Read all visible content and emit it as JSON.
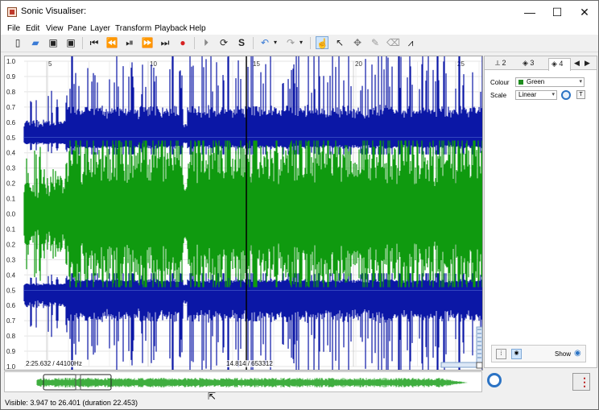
{
  "window": {
    "title": "Sonic Visualiser:",
    "controls": [
      "—",
      "☐",
      "✕"
    ]
  },
  "menu": [
    "File",
    "Edit",
    "View",
    "Pane",
    "Layer",
    "Transform",
    "Playback",
    "Help"
  ],
  "toolbar": {
    "icons": [
      "new-file-icon",
      "open-folder-icon",
      "save-icon",
      "save-as-icon",
      "rewind-start-icon",
      "rewind-icon",
      "play-pause-icon",
      "fast-forward-icon",
      "ffwd-end-icon",
      "record-icon",
      "play-selection-icon",
      "loop-icon",
      "solo-icon",
      "undo-icon",
      "redo-icon",
      "navigate-tool-icon",
      "select-tool-icon",
      "move-tool-icon",
      "draw-tool-icon",
      "erase-tool-icon",
      "measure-tool-icon"
    ],
    "selected_tool": "navigate-tool-icon"
  },
  "pane": {
    "time_ruler": [
      "5",
      "10",
      "15",
      "20",
      "25"
    ],
    "scale_labels_top": [
      "1.0",
      "0.9",
      "0.8",
      "0.7",
      "0.6",
      "0.5",
      "0.4",
      "0.3",
      "0.2",
      "0.1",
      "0.0",
      "0.1",
      "0.2",
      "0.3",
      "0.4",
      "0.5",
      "0.6",
      "0.7",
      "0.8",
      "0.9",
      "1.0"
    ],
    "left_readout": "2:25.632 / 44100Hz",
    "center_readout": "14.814 / 653312",
    "colors": {
      "blue_channel": "#0b17a6",
      "green_channel": "#0f9a0f",
      "playhead": "#000000"
    }
  },
  "properties": {
    "tabs": [
      "2",
      "3",
      "4"
    ],
    "active_tab": "4",
    "colour_label": "Colour",
    "colour_value": "Green",
    "scale_label": "Scale",
    "scale_value": "Linear",
    "show_label": "Show"
  },
  "overview": {
    "color": "#3fae3f"
  },
  "status": {
    "text": "Visible: 3.947 to 26.401 (duration 22.453)"
  }
}
